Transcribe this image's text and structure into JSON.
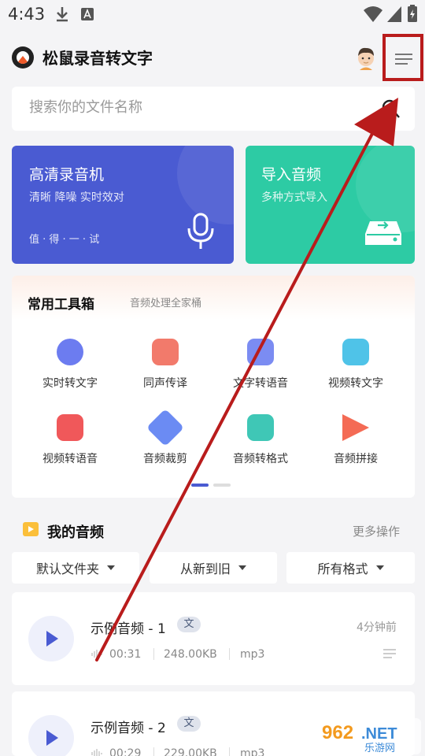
{
  "status_bar": {
    "time": "4:43"
  },
  "header": {
    "app_title": "松鼠录音转文字"
  },
  "search": {
    "placeholder": "搜索你的文件名称"
  },
  "cards": {
    "recorder": {
      "title": "高清录音机",
      "subtitle": "清晰 降噪 实时效对",
      "footer": "值 · 得 · 一 · 试"
    },
    "import": {
      "title": "导入音频",
      "subtitle": "多种方式导入"
    }
  },
  "toolbox": {
    "title": "常用工具箱",
    "subtitle": "音频处理全家桶",
    "tools": [
      {
        "label": "实时转文字",
        "icon": "realtime-transcribe-icon",
        "color": "#6c7cf0"
      },
      {
        "label": "同声传译",
        "icon": "simultaneous-translate-icon",
        "color": "#f27a6b"
      },
      {
        "label": "文字转语音",
        "icon": "text-to-speech-icon",
        "color": "#7b8cf2"
      },
      {
        "label": "视频转文字",
        "icon": "video-to-text-icon",
        "color": "#4fc3e8"
      },
      {
        "label": "视频转语音",
        "icon": "video-to-audio-icon",
        "color": "#f0585a"
      },
      {
        "label": "音频裁剪",
        "icon": "audio-cut-icon",
        "color": "#6b8bf3"
      },
      {
        "label": "音频转格式",
        "icon": "audio-convert-icon",
        "color": "#3fc7b6"
      },
      {
        "label": "音频拼接",
        "icon": "audio-merge-icon",
        "color": "#f46b55"
      }
    ]
  },
  "my_audio": {
    "title": "我的音频",
    "more": "更多操作",
    "filters": [
      "默认文件夹",
      "从新到旧",
      "所有格式"
    ],
    "files": [
      {
        "name": "示例音频 - 1",
        "tag": "文",
        "time": "4分钟前",
        "duration": "00:31",
        "size": "248.00KB",
        "format": "mp3"
      },
      {
        "name": "示例音频 - 2",
        "tag": "文",
        "time": "",
        "duration": "00:29",
        "size": "229.00KB",
        "format": "mp3"
      }
    ]
  },
  "colors": {
    "accent": "#4a5bd2",
    "import_card": "#2dcba4",
    "highlight": "#b91c1c"
  }
}
